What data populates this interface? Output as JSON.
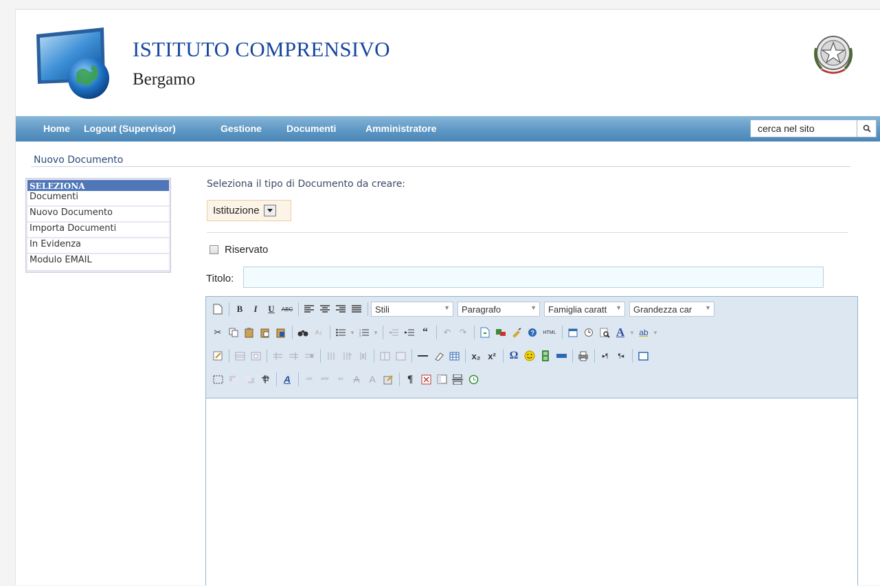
{
  "header": {
    "title": "ISTITUTO COMPRENSIVO",
    "subtitle": "Bergamo"
  },
  "nav": {
    "items": [
      "Home",
      "Logout (Supervisor)",
      "Gestione",
      "Documenti",
      "Amministratore"
    ],
    "search_value": "cerca nel sito"
  },
  "breadcrumb": "Nuovo Documento",
  "sidebar": {
    "header": "SELEZIONA",
    "items": [
      "Documenti",
      "Nuovo Documento",
      "Importa Documenti",
      "In Evidenza",
      "Modulo EMAIL"
    ]
  },
  "form": {
    "select_label": "Seleziona il tipo di Documento da creare:",
    "select_value": "Istituzione",
    "checkbox_label": "Riservato",
    "checkbox_checked": false,
    "title_label": "Titolo:",
    "title_value": ""
  },
  "editor": {
    "dropdowns": {
      "styles": "Stili",
      "format": "Paragrafo",
      "font_family": "Famiglia caratt",
      "font_size": "Grandezza car"
    },
    "bold": "B",
    "italic": "I",
    "underline": "U",
    "strike": "ABC",
    "html": "HTML",
    "subscript": "x₂",
    "superscript": "x²",
    "omega": "Ω",
    "pilcrow": "¶",
    "font_color": "A",
    "highlight": "ab"
  },
  "colors": {
    "nav_gradient_top": "#87b6d8",
    "nav_gradient_bottom": "#4b86b7",
    "title_blue": "#17479e",
    "sidebar_header": "#4f77b8",
    "toolbar_bg": "#dde7f2"
  }
}
